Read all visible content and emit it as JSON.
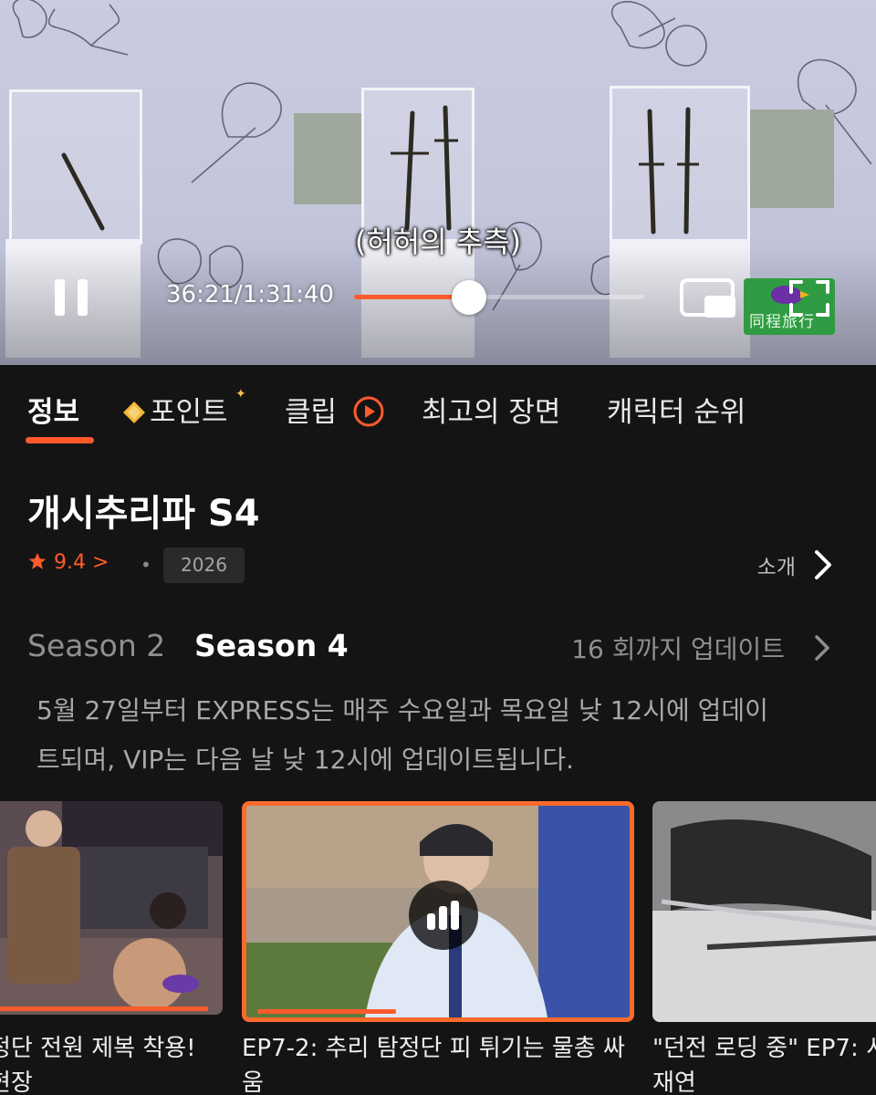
{
  "player": {
    "subtitle": "(허허의 추측)",
    "time_display": "36:21/1:31:40",
    "progress_fraction": 0.397,
    "ad_badge_text": "同程旅行",
    "icons": [
      "pause-icon",
      "picture-in-picture-icon",
      "fullscreen-icon"
    ]
  },
  "tabs": [
    {
      "label": "정보",
      "active": true
    },
    {
      "label": "포인트",
      "icon": "diamond-icon"
    },
    {
      "label": "클립",
      "icon": "circle-play-icon"
    },
    {
      "label": "최고의 장면"
    },
    {
      "label": "캐릭터 순위"
    }
  ],
  "show": {
    "title": "개시추리파 S4",
    "rating": "9.4",
    "rating_suffix": ">",
    "dot": "•",
    "year": "2026",
    "intro_label": "소개"
  },
  "seasons": {
    "items": [
      {
        "label": "Season 2",
        "active": false
      },
      {
        "label": "Season 4",
        "active": true
      }
    ],
    "update_info": "16 회까지 업데이트",
    "schedule_line1": "5월 27일부터 EXPRESS는 매주 수요일과 목요일 낮 12시에 업데이",
    "schedule_line2": "트되며, VIP는 다음 날 낮 12시에 업데이트됩니다."
  },
  "episodes": [
    {
      "title_line1": "정단 전원 제복 착용!",
      "title_line2": "현장",
      "progress_fraction": 1.0
    },
    {
      "title_line1": "EP7-2: 추리 탐정단 피 튀기는 물총 싸",
      "title_line2": "움",
      "progress_fraction": 0.38,
      "current": true
    },
    {
      "title_line1": "\"던전 로딩 중\" EP7: 서",
      "title_line2": "재연",
      "progress_fraction": 0
    }
  ],
  "colors": {
    "accent": "#ff5a2c",
    "background": "#141414",
    "muted_text": "#8f8f8f"
  }
}
